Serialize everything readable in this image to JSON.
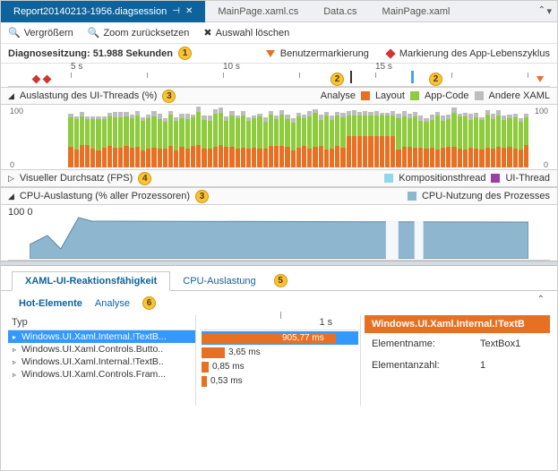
{
  "tabs": {
    "active": "Report20140213-1956.diagsession",
    "others": [
      "MainPage.xaml.cs",
      "Data.cs",
      "MainPage.xaml"
    ]
  },
  "toolbar": {
    "zoom_in": "Vergrößern",
    "zoom_reset": "Zoom zurücksetzen",
    "clear_sel": "Auswahl löschen"
  },
  "session": {
    "label": "Diagnosesitzung: 51.988 Sekunden",
    "user_mark": "Benutzermarkierung",
    "lifecycle": "Markierung des App-Lebenszyklus"
  },
  "ruler": {
    "ticks": [
      "5 s",
      "10 s",
      "15 s"
    ]
  },
  "ui_thread": {
    "title": "Auslastung des UI-Threads (%)",
    "legend": {
      "analyse": "Analyse",
      "layout": "Layout",
      "appcode": "App-Code",
      "other": "Andere XAML"
    },
    "ymax": "100",
    "colors": {
      "analyse": "#2f6fc1",
      "layout": "#e87022",
      "appcode": "#8ecb3d",
      "other": "#bdbdbd"
    }
  },
  "fps": {
    "title": "Visueller Durchsatz (FPS)",
    "legend": {
      "comp": "Kompositionsthread",
      "ui": "UI-Thread"
    },
    "colors": {
      "comp": "#8fd7ea",
      "ui": "#9c3fa3"
    }
  },
  "cpu": {
    "title": "CPU-Auslastung (% aller Prozessoren)",
    "legend": "CPU-Nutzung des Prozesses",
    "ymax": "100",
    "color": "#8fb6cf"
  },
  "lower": {
    "tab1": "XAML-UI-Reaktionsfähigkeit",
    "tab2": "CPU-Auslastung",
    "sub1": "Hot-Elemente",
    "sub2": "Analyse",
    "col_type": "Typ",
    "time_marker": "1 s",
    "rows": [
      {
        "name": "Windows.UI.Xaml.Internal.!TextB...",
        "dur": "905,77 ms",
        "w": 150
      },
      {
        "name": "Windows.UI.Xaml.Controls.Butto..",
        "dur": "3,65 ms",
        "w": 26
      },
      {
        "name": "Windows.UI.Xaml.Internal.!TextB..",
        "dur": "0,85 ms",
        "w": 8
      },
      {
        "name": "Windows.UI.Xaml.Controls.Fram...",
        "dur": "0,53 ms",
        "w": 6
      }
    ],
    "detail": {
      "title": "Windows.UI.Xaml.Internal.!TextB",
      "name_k": "Elementname:",
      "name_v": "TextBox1",
      "count_k": "Elementanzahl:",
      "count_v": "1"
    }
  },
  "chart_data": {
    "type": "bar",
    "title": "Auslastung des UI-Threads (%)",
    "ylabel": "%",
    "ylim": [
      0,
      100
    ],
    "x_seconds": [
      0,
      20
    ],
    "series": [
      {
        "name": "Analyse",
        "color": "#2f6fc1"
      },
      {
        "name": "Layout",
        "color": "#e87022"
      },
      {
        "name": "App-Code",
        "color": "#8ecb3d"
      },
      {
        "name": "Andere XAML",
        "color": "#bdbdbd"
      }
    ],
    "note": "Stacked bars ~90-100% total from ~2s to 20s; layout spike near 12-13s"
  }
}
